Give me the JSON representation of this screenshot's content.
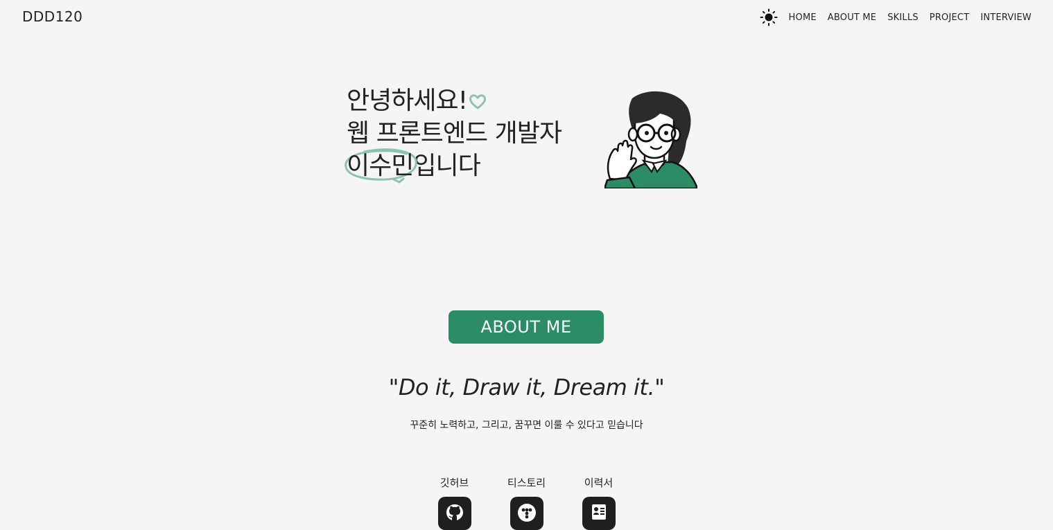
{
  "header": {
    "logo": "DDD120",
    "theme_icon": "sun-icon",
    "nav": [
      {
        "label": "HOME"
      },
      {
        "label": "ABOUT ME"
      },
      {
        "label": "SKILLS"
      },
      {
        "label": "PROJECT"
      },
      {
        "label": "INTERVIEW"
      }
    ]
  },
  "hero": {
    "line1": "안녕하세요!",
    "line2": "웹 프론트엔드 개발자",
    "name": "이수민",
    "line3_suffix": "입니다",
    "accent_color": "#8dc3ae",
    "avatar_icon": "developer-avatar-illustration"
  },
  "about": {
    "button_label": "ABOUT ME",
    "button_color": "#2b8c66",
    "motto": "\"Do it, Draw it, Dream it.\"",
    "motto_sub": "꾸준히 노력하고, 그리고, 꿈꾸면 이룰 수 있다고 믿습니다"
  },
  "links": [
    {
      "label": "깃허브",
      "icon": "github-icon"
    },
    {
      "label": "티스토리",
      "icon": "tistory-icon"
    },
    {
      "label": "이력서",
      "icon": "resume-icon"
    }
  ]
}
